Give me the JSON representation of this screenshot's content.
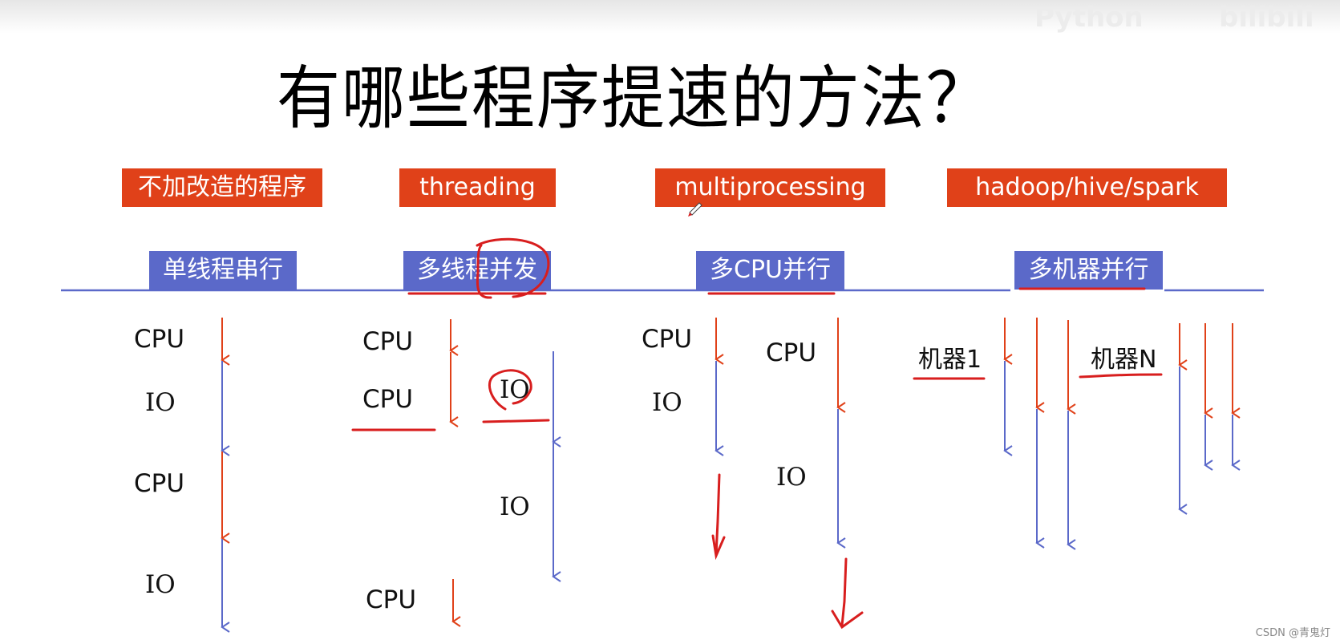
{
  "watermark": {
    "text": "Python",
    "brand": "bilibili"
  },
  "title": "有哪些程序提速的方法？",
  "columns": [
    {
      "tag": "不加改造的程序",
      "mode": "单线程串行"
    },
    {
      "tag": "threading",
      "mode": "多线程并发"
    },
    {
      "tag": "multiprocessing",
      "mode": "多CPU并行"
    },
    {
      "tag": "hadoop/hive/spark",
      "mode": "多机器并行"
    }
  ],
  "labels": {
    "serial": [
      "CPU",
      "IO",
      "CPU",
      "IO"
    ],
    "threading": [
      "CPU",
      "CPU",
      "IO",
      "IO",
      "CPU"
    ],
    "multiprocessing": [
      "CPU",
      "IO",
      "CPU",
      "IO"
    ],
    "machines": [
      "机器1",
      "机器N"
    ]
  },
  "colors": {
    "tag_bg": "#e04119",
    "mode_bg": "#5b69c9",
    "cpu_arrow": "#e04119",
    "io_arrow": "#5b69c9",
    "annotation": "#d81e1e"
  },
  "footer": "CSDN @青鬼灯"
}
